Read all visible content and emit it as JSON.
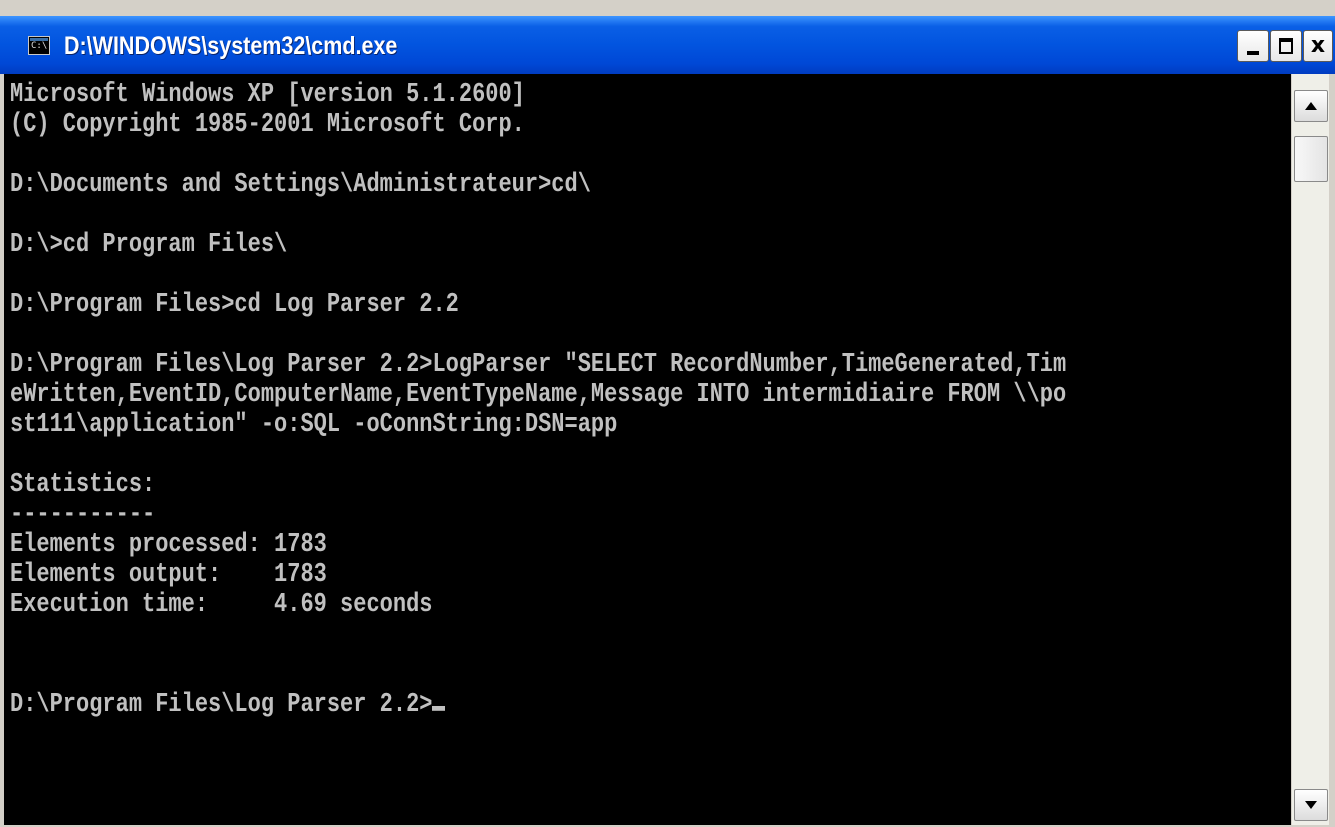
{
  "window": {
    "title": "D:\\WINDOWS\\system32\\cmd.exe",
    "icon_label": "C:\\",
    "minimize_label": "",
    "maximize_label": "",
    "close_label": "x"
  },
  "console": {
    "lines": [
      "Microsoft Windows XP [version 5.1.2600]",
      "(C) Copyright 1985-2001 Microsoft Corp.",
      "",
      "D:\\Documents and Settings\\Administrateur>cd\\",
      "",
      "D:\\>cd Program Files\\",
      "",
      "D:\\Program Files>cd Log Parser 2.2",
      "",
      "D:\\Program Files\\Log Parser 2.2>LogParser \"SELECT RecordNumber,TimeGenerated,Tim",
      "eWritten,EventID,ComputerName,EventTypeName,Message INTO intermidiaire FROM \\\\po",
      "st111\\application\" -o:SQL -oConnString:DSN=app",
      "",
      "Statistics:",
      "-----------",
      "Elements processed: 1783",
      "Elements output:    1783",
      "Execution time:     4.69 seconds",
      "",
      "",
      "D:\\Program Files\\Log Parser 2.2>"
    ]
  },
  "colors": {
    "console_bg": "#000000",
    "console_text": "#c0c0c0",
    "titlebar": "#0254df"
  },
  "icons": {
    "app": "cmd-icon",
    "scroll_up": "arrow-up-icon",
    "scroll_down": "arrow-down-icon"
  }
}
